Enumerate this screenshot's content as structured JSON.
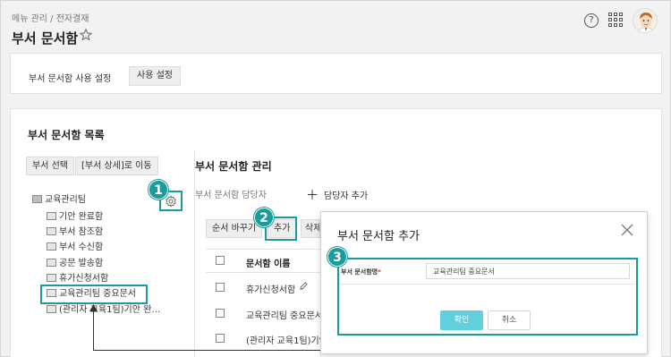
{
  "header": {
    "breadcrumb": "메뉴 관리 / 전자결재",
    "title": "부서 문서함"
  },
  "settings_card": {
    "label": "부서 문서함 사용 설정",
    "button": "사용 설정"
  },
  "list_card": {
    "title": "부서 문서함 목록",
    "dept_select_button": "부서 선택",
    "dept_detail_button": "[부서 상세]로 이동",
    "tree": {
      "root": "교육관리팀",
      "items": [
        "기안 완료함",
        "부서 참조함",
        "부서 수신함",
        "공문 발송함",
        "휴가신청서함",
        "교육관리팀 중요문서",
        "(관리자 교육1팀)기안 완…"
      ]
    }
  },
  "manage": {
    "title": "부서 문서함 관리",
    "owner_label": "부서 문서함 담당자",
    "add_owner": "담당자 추가",
    "reorder_button": "순서 바꾸기",
    "add_button": "추가",
    "delete_button": "삭제",
    "column_name": "문서함 이름",
    "rows": [
      "휴가신청서함",
      "교육관리팀 중요문서",
      "(관리자 교육1팀)기안"
    ]
  },
  "modal": {
    "title": "부서 문서함 추가",
    "field_label": "부서 문서함명",
    "field_required": "*",
    "field_value": "교육관리팀 중요문서",
    "confirm": "확인",
    "cancel": "취소"
  },
  "annotations": [
    "1",
    "2",
    "3"
  ],
  "colors": {
    "accent": "#1a9c9c",
    "confirm_button": "#5fd0dc"
  }
}
